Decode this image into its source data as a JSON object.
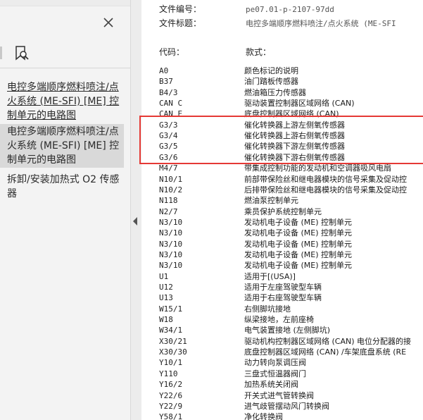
{
  "left_panel": {
    "bookmarks": [
      {
        "label": "电控多端顺序燃料喷注/点火系统 (ME-SFI) [ME] 控制单元的电路图",
        "selected": false
      },
      {
        "label": "电控多端顺序燃料喷注/点火系统 (ME-SFI) [ME] 控制单元的电路图",
        "selected": true
      },
      {
        "label": "拆卸/安装加热式 O2 传感器",
        "selected": false
      }
    ]
  },
  "document": {
    "doc_number_label": "文件编号：",
    "doc_number_value": "pe07.01-p-2107-97dd",
    "doc_title_label": "文件标题：",
    "doc_title_value": "电控多端顺序燃料喷注/点火系统 (ME-SFI",
    "col_code": "代码：",
    "col_text": "款式：",
    "rows": [
      {
        "code": "A0",
        "desc": "颜色标记的说明"
      },
      {
        "code": "B37",
        "desc": "油门踏板传感器"
      },
      {
        "code": "B4/3",
        "desc": "燃油箱压力传感器"
      },
      {
        "code": "CAN C",
        "desc": "驱动装置控制器区域网络 (CAN)"
      },
      {
        "code": "CAN E",
        "desc": "底盘控制器区域网络 (CAN)"
      },
      {
        "code": "G3/3",
        "desc": "催化转换器上游左侧氧传感器"
      },
      {
        "code": "G3/4",
        "desc": "催化转换器上游右侧氧传感器"
      },
      {
        "code": "G3/5",
        "desc": "催化转换器下游左侧氧传感器"
      },
      {
        "code": "G3/6",
        "desc": "催化转换器下游右侧氧传感器"
      },
      {
        "code": "M4/7",
        "desc": "带集成控制功能的发动机和空调器吸风电扇"
      },
      {
        "code": "N10/1",
        "desc": "前部带保险丝和继电器模块的信号采集及促动控"
      },
      {
        "code": "N10/2",
        "desc": "后排带保险丝和继电器模块的信号采集及促动控"
      },
      {
        "code": "N118",
        "desc": "燃油泵控制单元"
      },
      {
        "code": "N2/7",
        "desc": "乘员保护系统控制单元"
      },
      {
        "code": "N3/10",
        "desc": "发动机电子设备 (ME) 控制单元"
      },
      {
        "code": "N3/10",
        "desc": "发动机电子设备 (ME) 控制单元"
      },
      {
        "code": "N3/10",
        "desc": "发动机电子设备 (ME) 控制单元"
      },
      {
        "code": "N3/10",
        "desc": "发动机电子设备 (ME) 控制单元"
      },
      {
        "code": "N3/10",
        "desc": "发动机电子设备 (ME) 控制单元"
      },
      {
        "code": "U1",
        "desc": "适用于[(USA)]"
      },
      {
        "code": "U12",
        "desc": "适用于左座驾驶型车辆"
      },
      {
        "code": "U13",
        "desc": "适用于右座驾驶型车辆"
      },
      {
        "code": "W15/1",
        "desc": "右侧脚坑接地"
      },
      {
        "code": "W18",
        "desc": "纵梁接地，左前座椅"
      },
      {
        "code": "W34/1",
        "desc": "电气装置接地 (左侧脚坑)"
      },
      {
        "code": "X30/21",
        "desc": "驱动机构控制器区域网络 (CAN) 电位分配器的接"
      },
      {
        "code": "X30/30",
        "desc": "底盘控制器区域网络 (CAN) /车架底盘系统 (RE"
      },
      {
        "code": "Y10/1",
        "desc": "动力转向泵调压阀"
      },
      {
        "code": "Y110",
        "desc": "三盘式恒温器阀门"
      },
      {
        "code": "Y16/2",
        "desc": "加热系统关闭阀"
      },
      {
        "code": "Y22/6",
        "desc": "开关式进气管转换阀"
      },
      {
        "code": "Y22/9",
        "desc": "进气歧管摆动风门转换阀"
      },
      {
        "code": "Y58/1",
        "desc": "净化转换阀"
      }
    ]
  },
  "colors": {
    "highlight": "#e53935",
    "panel_bg": "#f3f3f3",
    "selected_bg": "#d9d9d9"
  }
}
